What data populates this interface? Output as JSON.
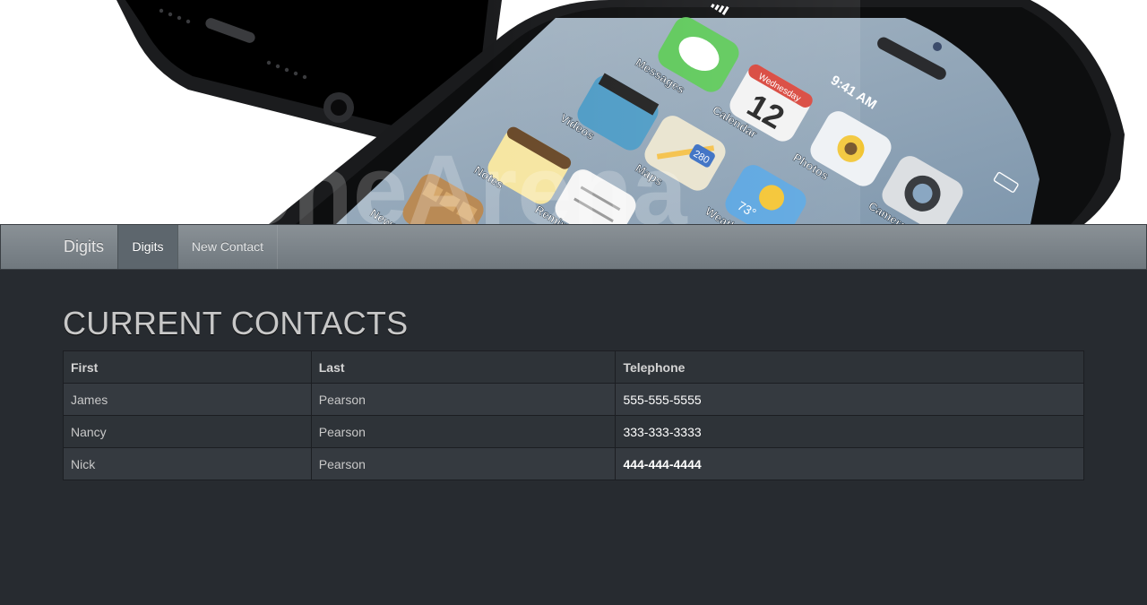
{
  "hero": {
    "watermark": "phoneArena",
    "screen": {
      "status_time": "9:41 AM",
      "calendar_day": "Wednesday",
      "calendar_date": "12",
      "maps_shield": "280",
      "weather_temp": "73°",
      "apps": [
        "Messages",
        "Calendar",
        "Videos",
        "Photos",
        "Notes",
        "Maps",
        "Camera",
        "Weather",
        "Newsstand",
        "Reminders"
      ]
    }
  },
  "navbar": {
    "brand": "Digits",
    "items": [
      {
        "label": "Digits",
        "active": true
      },
      {
        "label": "New Contact",
        "active": false
      }
    ]
  },
  "main": {
    "title": "CURRENT CONTACTS",
    "table": {
      "headers": [
        "First",
        "Last",
        "Telephone"
      ],
      "rows": [
        [
          "James",
          "Pearson",
          "555-555-5555"
        ],
        [
          "Nancy",
          "Pearson",
          "333-333-3333"
        ],
        [
          "Nick",
          "Pearson",
          "444-444-4444"
        ]
      ]
    }
  },
  "colors": {
    "page_bg": "#272b30",
    "navbar": "#7a8288",
    "nav_active": "#5d666d",
    "table_row_odd": "#353a40",
    "table_row_even": "#2e3338"
  }
}
